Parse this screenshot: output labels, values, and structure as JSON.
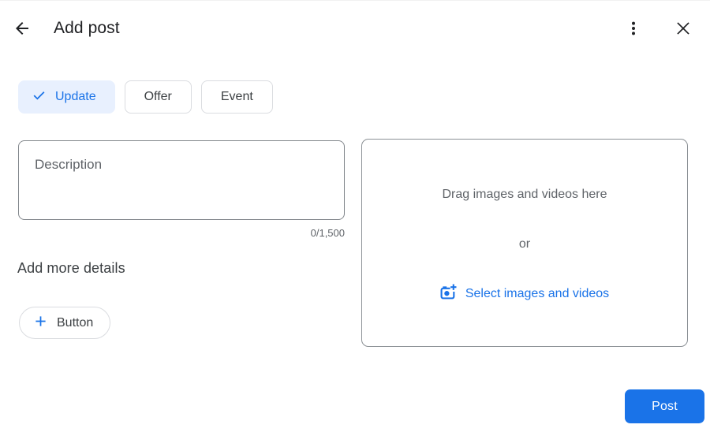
{
  "header": {
    "title": "Add post",
    "back_icon": "arrow-back",
    "more_icon": "more-vertical",
    "close_icon": "close-x"
  },
  "post_type_tabs": [
    {
      "label": "Update",
      "selected": true,
      "icon": "checkmark"
    },
    {
      "label": "Offer",
      "selected": false
    },
    {
      "label": "Event",
      "selected": false
    }
  ],
  "description": {
    "placeholder": "Description",
    "value": "",
    "counter": "0/1,500"
  },
  "details": {
    "heading": "Add more details",
    "button_chip_label": "Button",
    "button_chip_icon": "plus"
  },
  "media": {
    "drag_text": "Drag images and videos here",
    "or_text": "or",
    "select_link": "Select images and videos",
    "select_icon": "add-photo"
  },
  "footer": {
    "post_label": "Post"
  },
  "colors": {
    "accent_blue": "#1a73e8",
    "selected_chip_bg": "#e8f0fe",
    "text_dark": "#202124",
    "text_gray": "#5f6368",
    "chip_border": "#dadce0",
    "input_border": "#82878c"
  }
}
